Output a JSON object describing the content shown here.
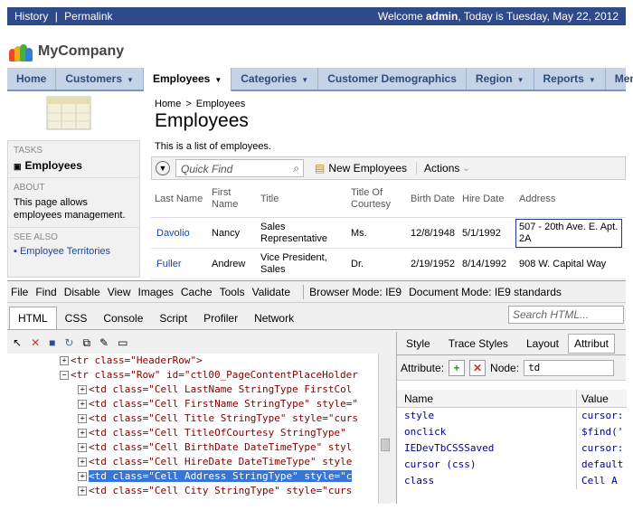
{
  "topbar": {
    "links": [
      "History",
      "Permalink"
    ],
    "welcome_prefix": "Welcome ",
    "user": "admin",
    "welcome_suffix": ", Today is Tuesday, May 22, 2012"
  },
  "brand": {
    "name": "MyCompany"
  },
  "menu": [
    {
      "label": "Home",
      "caret": false
    },
    {
      "label": "Customers",
      "caret": true
    },
    {
      "label": "Employees",
      "caret": true,
      "active": true
    },
    {
      "label": "Categories",
      "caret": true
    },
    {
      "label": "Customer Demographics",
      "caret": false
    },
    {
      "label": "Region",
      "caret": true
    },
    {
      "label": "Reports",
      "caret": true
    },
    {
      "label": "Memb",
      "caret": false
    }
  ],
  "sidebar": {
    "tasks_header": "TASKS",
    "task_item": "Employees",
    "about_header": "ABOUT",
    "about_text": "This page allows employees management.",
    "see_also_header": "SEE ALSO",
    "see_also_link": "Employee Territories"
  },
  "page": {
    "crumb_home": "Home",
    "crumb_sep": ">",
    "crumb_current": "Employees",
    "title": "Employees",
    "description": "This is a list of employees."
  },
  "toolbar": {
    "quick_find_placeholder": "Quick Find",
    "new_label": "New Employees",
    "actions_label": "Actions"
  },
  "grid": {
    "headers": [
      "Last Name",
      "First Name",
      "Title",
      "Title Of Courtesy",
      "Birth Date",
      "Hire Date",
      "Address"
    ],
    "rows": [
      [
        "Davolio",
        "Nancy",
        "Sales Representative",
        "Ms.",
        "12/8/1948",
        "5/1/1992",
        "507 - 20th Ave. E. Apt. 2A"
      ],
      [
        "Fuller",
        "Andrew",
        "Vice President, Sales",
        "Dr.",
        "2/19/1952",
        "8/14/1992",
        "908 W. Capital Way"
      ]
    ]
  },
  "devtools": {
    "menu": [
      "File",
      "Find",
      "Disable",
      "View",
      "Images",
      "Cache",
      "Tools",
      "Validate"
    ],
    "browser_mode": "Browser Mode: IE9",
    "doc_mode": "Document Mode: IE9 standards",
    "tabs": [
      "HTML",
      "CSS",
      "Console",
      "Script",
      "Profiler",
      "Network"
    ],
    "search_placeholder": "Search HTML...",
    "tree": [
      {
        "text": "<tr class=\"HeaderRow\">",
        "indent": 1
      },
      {
        "text": "<tr class=\"Row\" id=\"ctl00_PageContentPlaceHolder",
        "indent": 1
      },
      {
        "text": "<td class=\"Cell  LastName StringType FirstCol",
        "indent": 2
      },
      {
        "text": "<td class=\"Cell  FirstName StringType\" style=\"",
        "indent": 2
      },
      {
        "text": "<td class=\"Cell  Title StringType\" style=\"curs",
        "indent": 2
      },
      {
        "text": "<td class=\"Cell  TitleOfCourtesy StringType\"",
        "indent": 2
      },
      {
        "text": "<td class=\"Cell  BirthDate DateTimeType\" styl",
        "indent": 2
      },
      {
        "text": "<td class=\"Cell  HireDate DateTimeType\" style",
        "indent": 2
      },
      {
        "text": "<td class=\"Cell  Address StringType\" style=\"c",
        "indent": 2,
        "selected": true
      },
      {
        "text": "<td class=\"Cell  City StringType\" style=\"curs",
        "indent": 2
      }
    ],
    "right_tabs": [
      "Style",
      "Trace Styles",
      "Layout",
      "Attribut"
    ],
    "attribute_label": "Attribute:",
    "node_label": "Node:",
    "node_value": "td",
    "prop_headers": [
      "Name",
      "Value"
    ],
    "props": [
      {
        "name": "style",
        "value": "cursor:"
      },
      {
        "name": "onclick",
        "value": "$find('"
      },
      {
        "name": "IEDevTbCSSSaved",
        "value": "cursor:"
      },
      {
        "name": "cursor (css)",
        "value": "default"
      },
      {
        "name": "class",
        "value": "Cell  A"
      }
    ]
  }
}
